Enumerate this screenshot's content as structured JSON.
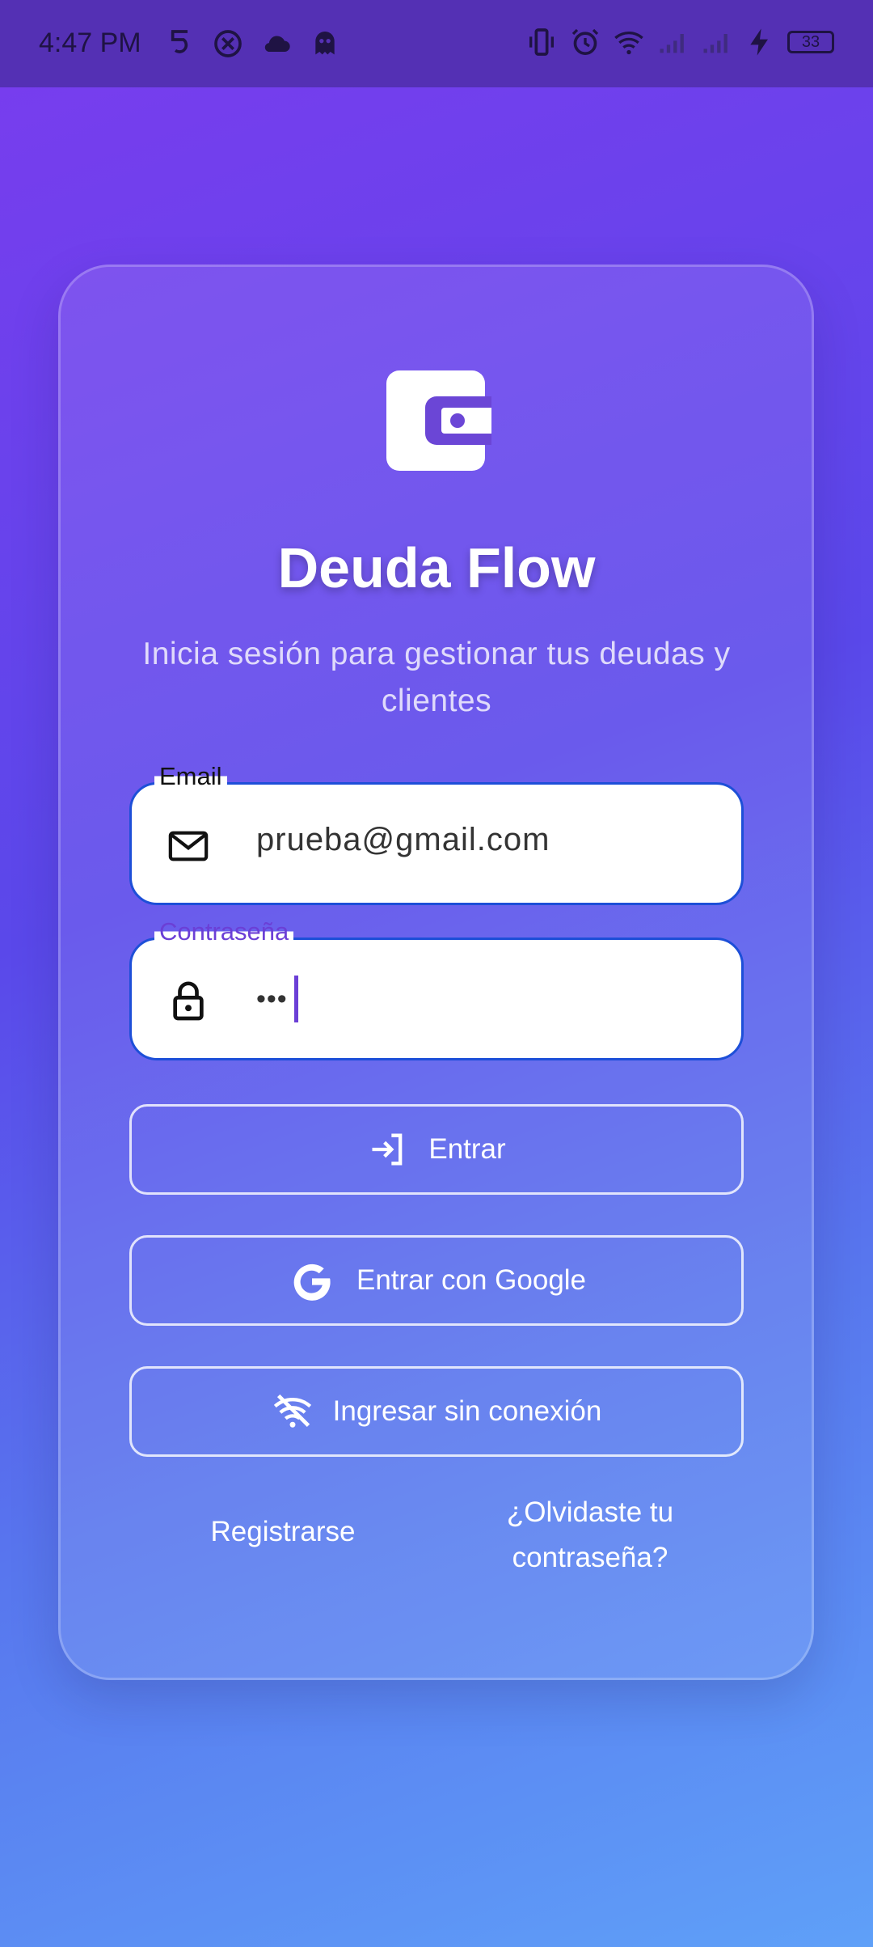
{
  "status_bar": {
    "time": "4:47 PM",
    "battery": "33",
    "icons": [
      "s-app-icon",
      "close-circle-icon",
      "cloud-icon",
      "ghost-icon",
      "vibrate-icon",
      "alarm-icon",
      "wifi-icon",
      "signal-icon",
      "signal-icon",
      "charging-icon",
      "battery-icon"
    ]
  },
  "app": {
    "logo_icon": "wallet-icon",
    "title": "Deuda Flow",
    "subtitle": "Inicia sesión para gestionar tus deudas y clientes"
  },
  "form": {
    "email": {
      "label": "Email",
      "value": "prueba@gmail.com",
      "icon": "mail-icon"
    },
    "password": {
      "label": "Contraseña",
      "value": "•••",
      "icon": "lock-icon"
    }
  },
  "buttons": {
    "login": {
      "label": "Entrar",
      "icon": "login-icon"
    },
    "google": {
      "label": "Entrar con Google",
      "icon": "google-icon"
    },
    "offline": {
      "label": "Ingresar sin conexión",
      "icon": "wifi-off-icon"
    }
  },
  "links": {
    "register": "Registrarse",
    "forgot": "¿Olvidaste tu contraseña?"
  },
  "colors": {
    "accent": "#6b3fd6",
    "field_border": "#1d4fd8",
    "status_bar": "#5430b4"
  }
}
